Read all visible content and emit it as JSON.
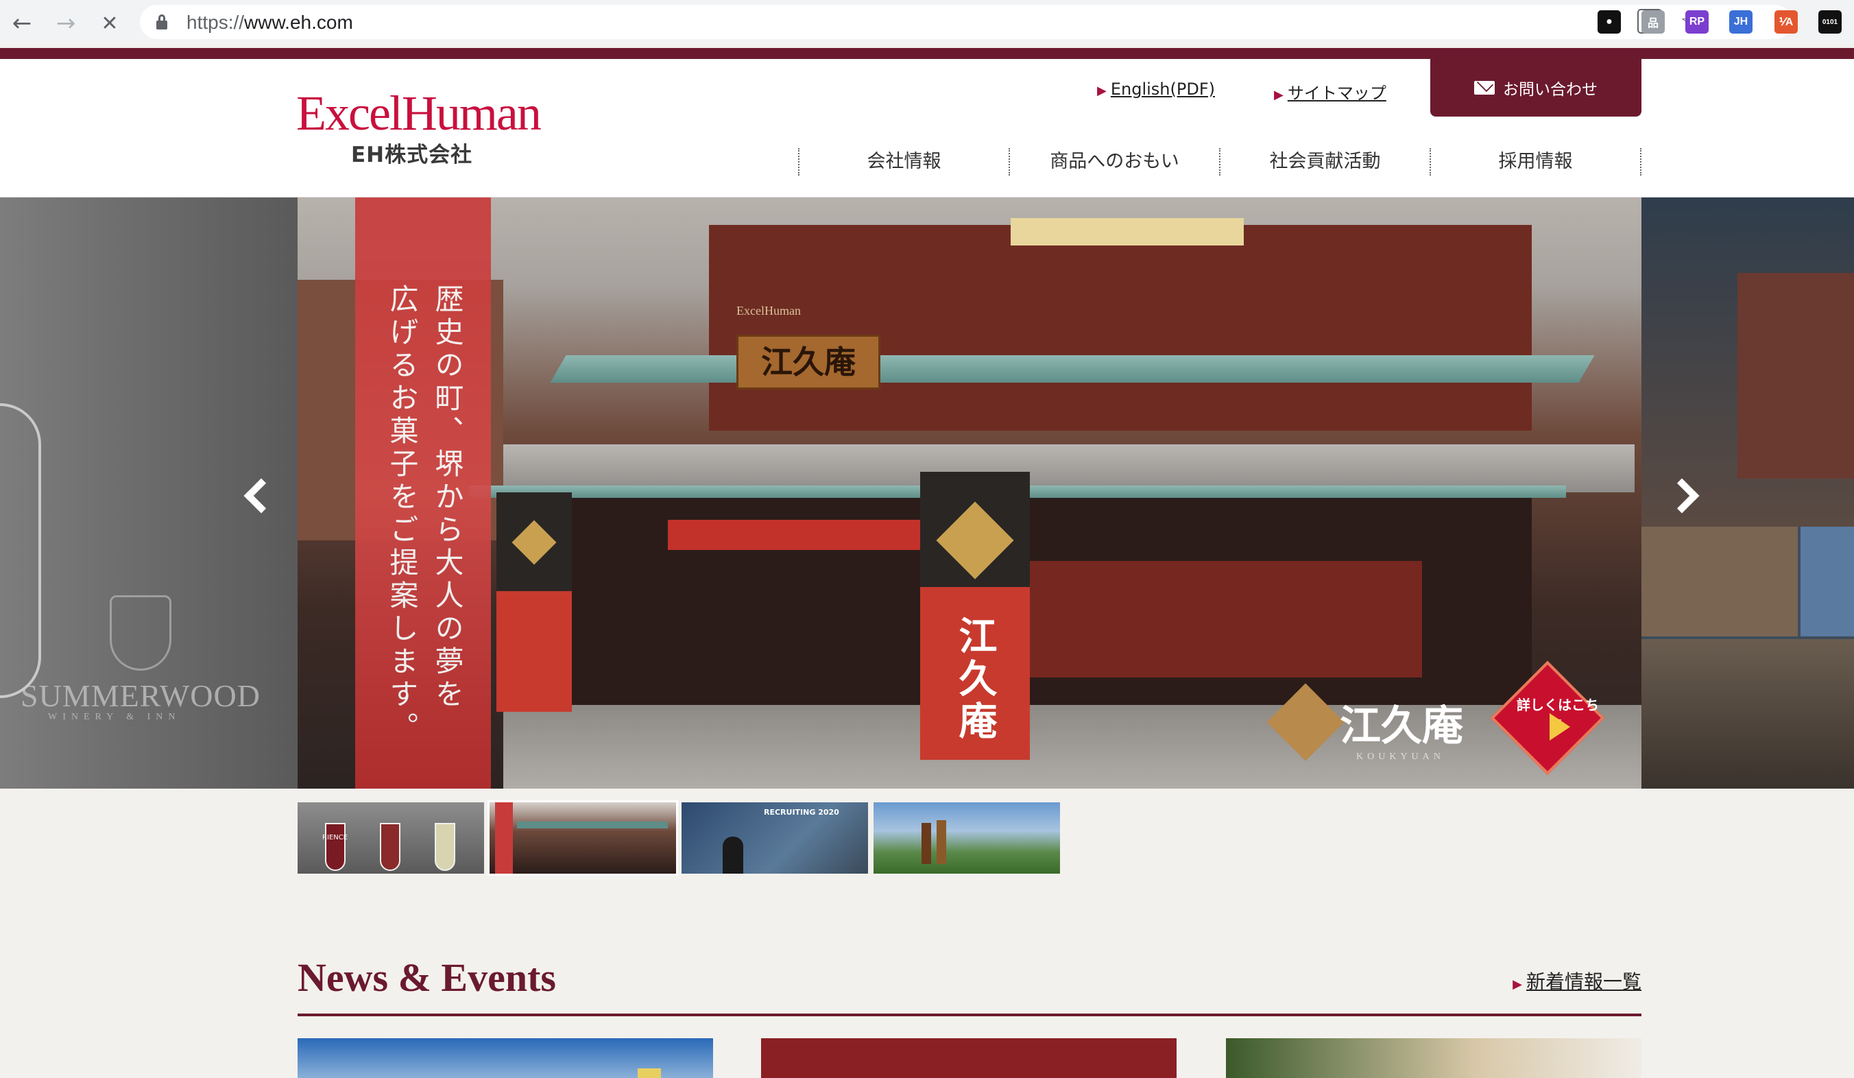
{
  "browser": {
    "back_icon": "←",
    "forward_icon": "→",
    "stop_icon": "✕",
    "url_scheme": "https://",
    "url_host": "www.eh.com",
    "translate_icon": "文",
    "star_icon": "☆",
    "extensions": [
      {
        "name": "github-icon",
        "label": "●",
        "color": "#111111"
      },
      {
        "name": "sitemap-ext-icon",
        "label": "品",
        "color": "#9aa0a6"
      },
      {
        "name": "rp-ext-icon",
        "label": "RP",
        "color": "#7b3fcf"
      },
      {
        "name": "jh-ext-icon",
        "label": "JH",
        "color": "#3b6fd8"
      },
      {
        "name": "wappalyzer-icon",
        "label": "⅟A",
        "color": "#e4572e"
      },
      {
        "name": "binary-ext-icon",
        "label": "0101",
        "color": "#111111"
      }
    ]
  },
  "site": {
    "logo_en": "ExcelHuman",
    "logo_ja": "EH株式会社",
    "util_links": [
      {
        "label": "English(PDF)"
      },
      {
        "label": "サイトマップ"
      }
    ],
    "contact_label": "お問い合わせ",
    "nav": [
      "会社情報",
      "商品へのおもい",
      "社会貢献活動",
      "採用情報"
    ],
    "accent_color": "#6b1a2e",
    "logo_color": "#c8103e"
  },
  "hero": {
    "left_brand": "SUMMERWOOD",
    "left_brand_sub": "WINERY & INN",
    "banner_line1": "歴史の町、堺から大人の夢を",
    "banner_line2": "広げるお菓子をご提案します。",
    "shop_sign": "江久庵",
    "shop_sign_small": "ExcelHuman",
    "flag_text": "江久庵",
    "brand_name": "江久庵",
    "brand_roman": "KOUKYUAN",
    "detail_label": "詳しくはこちら",
    "prev_icon": "chevron-left",
    "next_icon": "chevron-right"
  },
  "thumbnails": [
    {
      "name": "wine-glasses",
      "caption": "RIENCE"
    },
    {
      "name": "koukyuan-shop",
      "caption": ""
    },
    {
      "name": "recruiting",
      "caption": "RECRUITING 2020"
    },
    {
      "name": "landscape-bottles",
      "caption": ""
    }
  ],
  "news": {
    "title": "News & Events",
    "more_label": "新着情報一覧"
  }
}
